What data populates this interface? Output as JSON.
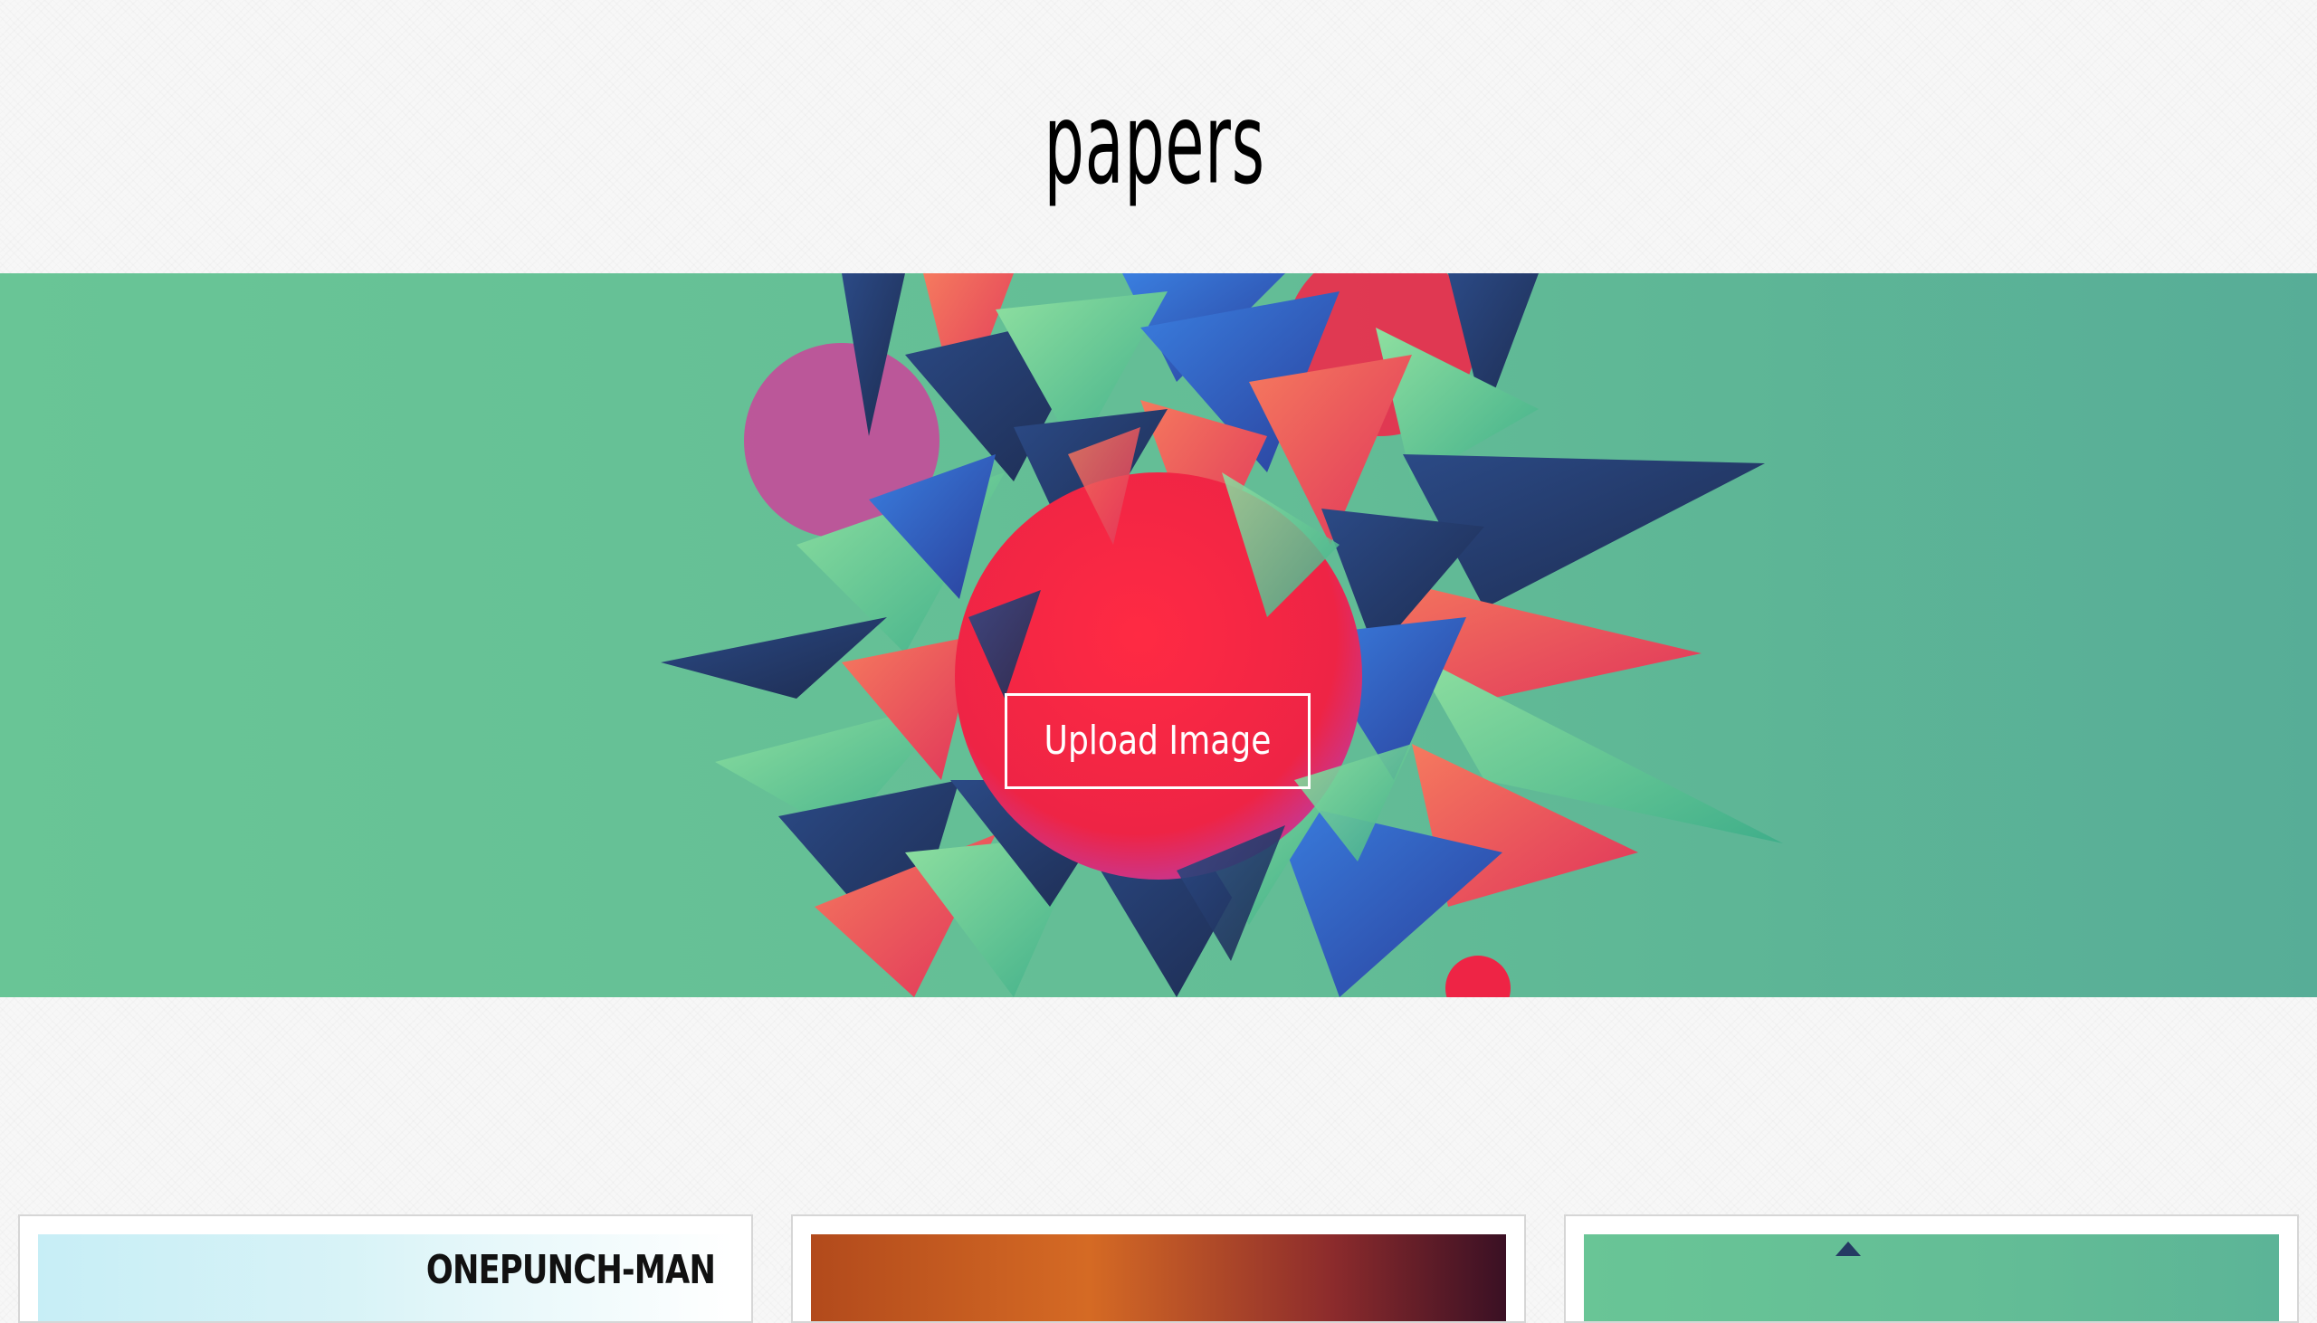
{
  "header": {
    "logo_text": "papers"
  },
  "hero": {
    "upload_label": "Upload Image",
    "colors": {
      "background_left": "#69c596",
      "background_right": "#57ad97",
      "sphere": "#ee2445",
      "shard_navy": "#253a63",
      "shard_blue": "#2f63c8",
      "shard_green": "#6fd69a",
      "shard_coral": "#f36b5e"
    }
  },
  "gallery": {
    "cards": [
      {
        "caption": "ONEPUNCH-MAN"
      },
      {
        "caption": ""
      },
      {
        "caption": ""
      }
    ]
  }
}
